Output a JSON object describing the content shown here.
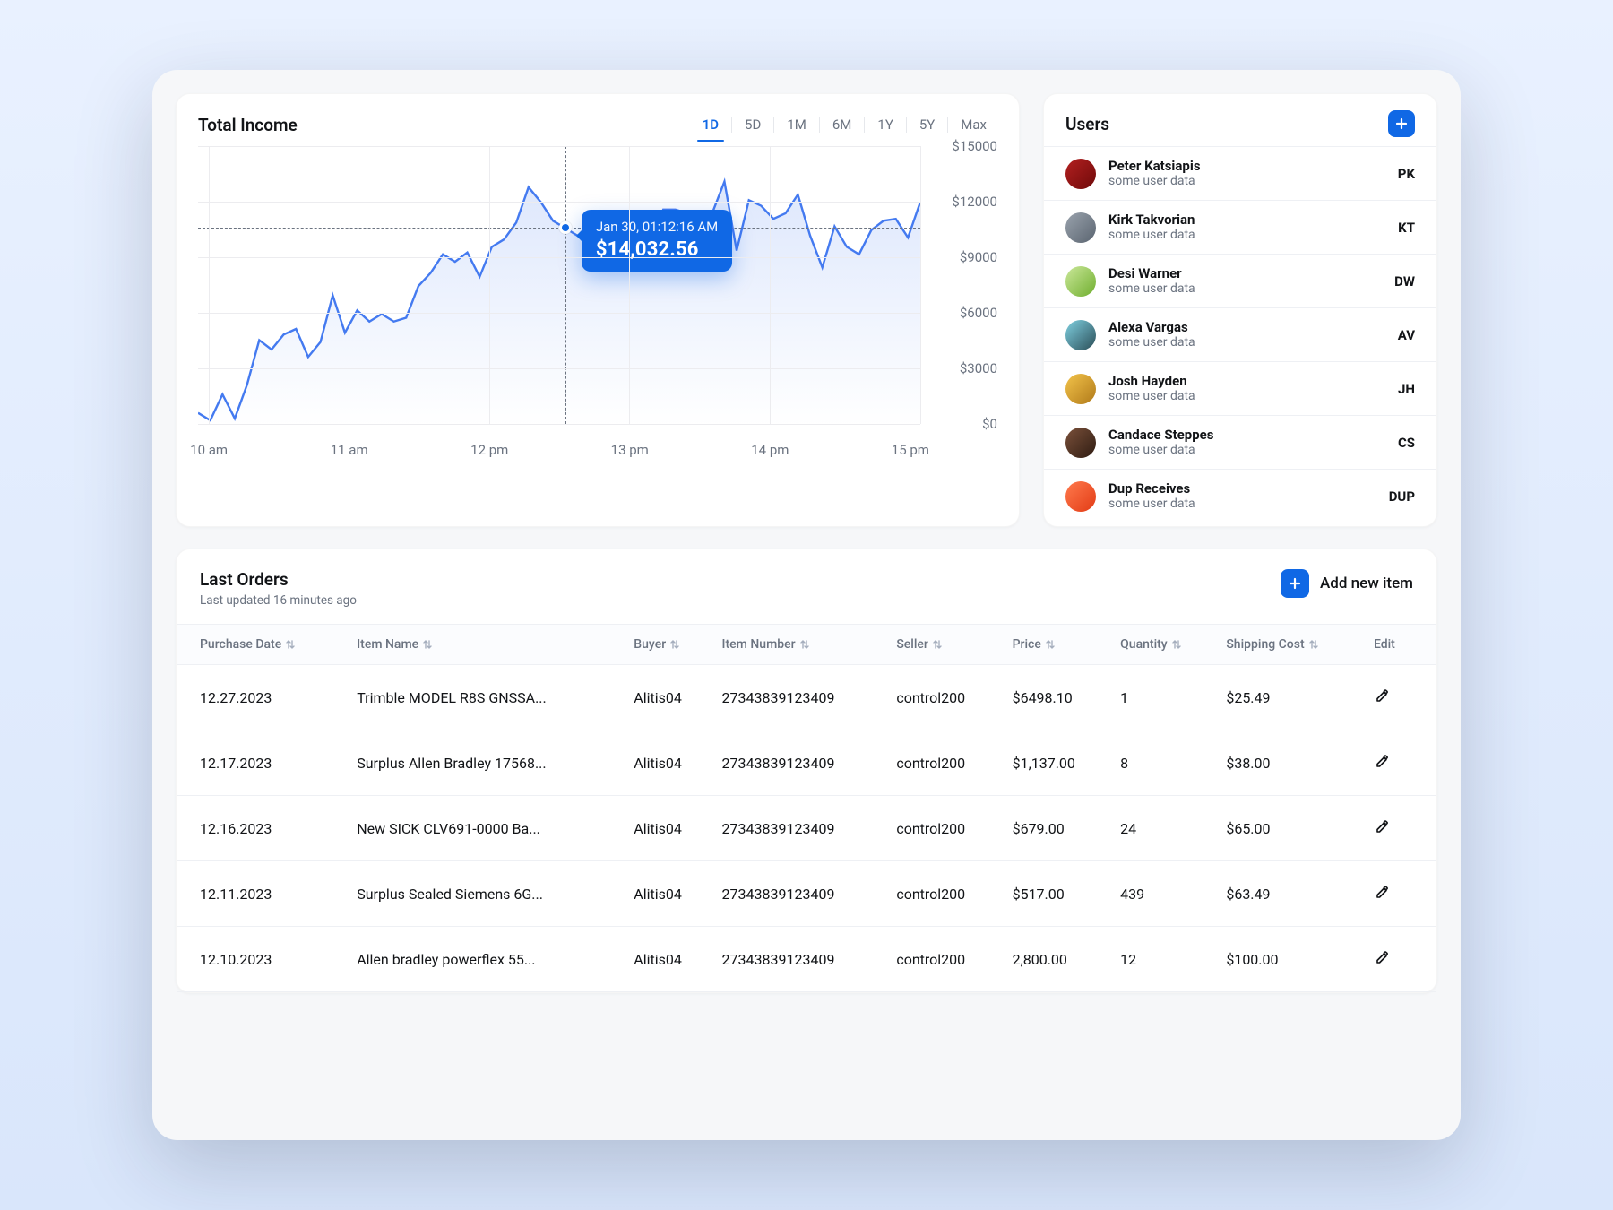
{
  "chart": {
    "title": "Total Income",
    "ranges": [
      "1D",
      "5D",
      "1M",
      "6M",
      "1Y",
      "5Y",
      "Max"
    ],
    "active_range": "1D",
    "yticks": [
      "$15000",
      "$12000",
      "$9000",
      "$6000",
      "$3000",
      "$0"
    ],
    "xticks": [
      "10 am",
      "11 am",
      "12 pm",
      "13 pm",
      "14 pm",
      "15 pm"
    ],
    "tooltip": {
      "timestamp": "Jan 30, 01:12:16 AM",
      "value": "$14,032.56"
    }
  },
  "chart_data": {
    "type": "line",
    "title": "Total Income",
    "xlabel": "",
    "ylabel": "",
    "ylim": [
      0,
      15000
    ],
    "y_ticks": [
      0,
      3000,
      6000,
      9000,
      12000,
      15000
    ],
    "x_labels": [
      "10 am",
      "11 am",
      "12 pm",
      "13 pm",
      "14 pm",
      "15 pm"
    ],
    "series": [
      {
        "name": "Total Income",
        "color": "#447af0",
        "values": [
          700,
          300,
          1700,
          400,
          2200,
          4600,
          4100,
          4900,
          5200,
          3700,
          4500,
          7000,
          5000,
          6200,
          5600,
          6000,
          5600,
          5800,
          7500,
          8200,
          9200,
          8800,
          9300,
          8000,
          9600,
          10000,
          10900,
          12800,
          12000,
          11000,
          10600,
          10200,
          10600,
          10200,
          10000,
          9200,
          10800,
          10000,
          11600,
          11600,
          11400,
          11300,
          11400,
          13100,
          9400,
          12100,
          11800,
          11100,
          11400,
          12400,
          10200,
          8500,
          10700,
          9600,
          9200,
          10500,
          11000,
          11100,
          10100,
          12000
        ]
      }
    ],
    "highlight_point": {
      "index": 30,
      "value": 14032.56,
      "timestamp": "Jan 30, 01:12:16 AM"
    }
  },
  "users": {
    "title": "Users",
    "items": [
      {
        "name": "Peter Katsiapis",
        "sub": "some user data",
        "initials": "PK",
        "av": "linear-gradient(135deg,#b32020,#6f0a0a)"
      },
      {
        "name": "Kirk Takvorian",
        "sub": "some user data",
        "initials": "KT",
        "av": "linear-gradient(135deg,#9aa3ad,#5a6470)"
      },
      {
        "name": "Desi Warner",
        "sub": "some user data",
        "initials": "DW",
        "av": "linear-gradient(135deg,#cbe89a,#6fae2e)"
      },
      {
        "name": "Alexa Vargas",
        "sub": "some user data",
        "initials": "AV",
        "av": "linear-gradient(135deg,#7fd0e0,#2a4d57)"
      },
      {
        "name": "Josh Hayden",
        "sub": "some user data",
        "initials": "JH",
        "av": "linear-gradient(135deg,#f3c34a,#b07a1a)"
      },
      {
        "name": "Candace Steppes",
        "sub": "some user data",
        "initials": "CS",
        "av": "linear-gradient(135deg,#7a503a,#2f1c12)"
      },
      {
        "name": "Dup Receives",
        "sub": "some user data",
        "initials": "DUP",
        "av": "linear-gradient(135deg,#ff7a4d,#e23b15)"
      }
    ]
  },
  "orders": {
    "title": "Last Orders",
    "subtitle": "Last updated 16 minutes ago",
    "add_label": "Add new item",
    "columns": [
      "Purchase Date",
      "Item Name",
      "Buyer",
      "Item Number",
      "Seller",
      "Price",
      "Quantity",
      "Shipping Cost",
      "Edit"
    ],
    "rows": [
      {
        "date": "12.27.2023",
        "name": "Trimble MODEL R8S GNSSA...",
        "buyer": "Alitis04",
        "itemno": "27343839123409",
        "seller": "control200",
        "price": "$6498.10",
        "qty": "1",
        "ship": "$25.49"
      },
      {
        "date": "12.17.2023",
        "name": "Surplus Allen Bradley 17568...",
        "buyer": "Alitis04",
        "itemno": "27343839123409",
        "seller": "control200",
        "price": "$1,137.00",
        "qty": "8",
        "ship": "$38.00"
      },
      {
        "date": "12.16.2023",
        "name": "New SICK CLV691-0000 Ba...",
        "buyer": "Alitis04",
        "itemno": "27343839123409",
        "seller": "control200",
        "price": "$679.00",
        "qty": "24",
        "ship": "$65.00"
      },
      {
        "date": "12.11.2023",
        "name": "Surplus Sealed Siemens 6G...",
        "buyer": "Alitis04",
        "itemno": "27343839123409",
        "seller": "control200",
        "price": "$517.00",
        "qty": "439",
        "ship": "$63.49"
      },
      {
        "date": "12.10.2023",
        "name": "Allen bradley powerflex 55...",
        "buyer": "Alitis04",
        "itemno": "27343839123409",
        "seller": "control200",
        "price": "2,800.00",
        "qty": "12",
        "ship": "$100.00"
      }
    ]
  }
}
